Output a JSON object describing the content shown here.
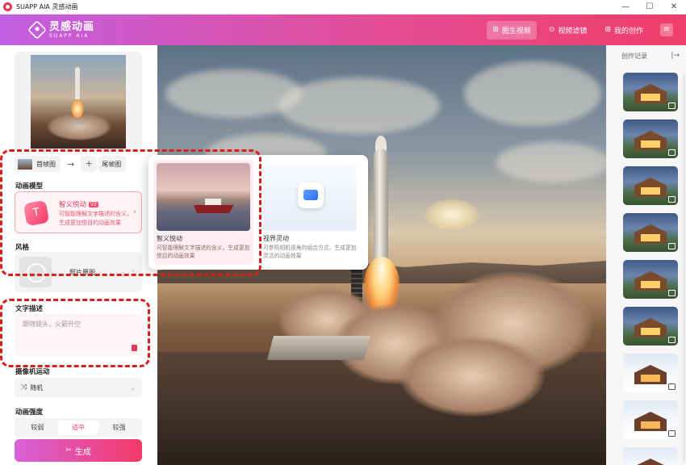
{
  "window": {
    "title": "SUAPP AIA 灵感动画",
    "controls": {
      "minimize": "—",
      "maximize": "☐",
      "close": "✕"
    }
  },
  "header": {
    "brand_name": "灵感动画",
    "brand_sub": "SUAPP AIA",
    "nav": [
      {
        "label": "图生视频",
        "icon": "image-icon",
        "glyph": "⊞",
        "active": true
      },
      {
        "label": "视频滤镜",
        "icon": "play-icon",
        "glyph": "⊙",
        "active": false
      },
      {
        "label": "我的创作",
        "icon": "grid-icon",
        "glyph": "⊞",
        "active": false
      }
    ],
    "menu_glyph": "≡"
  },
  "left": {
    "frames": {
      "first": "首帧图",
      "arrow": "→",
      "add": "+",
      "last": "尾帧图"
    },
    "model_label": "动画模型",
    "model": {
      "name": "智义悦动",
      "badge": "V2",
      "desc": "可智能理解文字描述的含义，生成更加悦目的动画效果",
      "chevron": "›"
    },
    "style_label": "风格",
    "style": {
      "name": "照片原图",
      "chevron": "›"
    },
    "text_label": "文字描述",
    "text_placeholder": "跟随镜头，火箭升空",
    "camera_label": "摄像机运动",
    "camera": {
      "icon_glyph": "⤨",
      "value": "随机",
      "chevron": "⌄"
    },
    "strength_label": "动画强度",
    "strength": [
      {
        "label": "较弱",
        "active": false
      },
      {
        "label": "适中",
        "active": true
      },
      {
        "label": "较强",
        "active": false
      }
    ],
    "generate": {
      "icon_glyph": "✂",
      "label": "生成"
    }
  },
  "popup": {
    "options": [
      {
        "name": "智义悦动",
        "desc": "可智能理解文字描述的含义，生成更加悦目的动画效果",
        "selected": true
      },
      {
        "name": "视界灵动",
        "desc": "可参照相机视角的组合方式，生成更加灵活的动画效果",
        "selected": false
      }
    ]
  },
  "right": {
    "title": "创作记录",
    "collapse_glyph": "|→",
    "thumbnails": [
      "house",
      "house",
      "house",
      "house",
      "house",
      "house",
      "snow",
      "snow",
      "snow"
    ]
  },
  "colors": {
    "accent": "#f0445e",
    "header_start": "#c25ee2",
    "header_end": "#f03e6a",
    "highlight": "#d91e1e"
  }
}
